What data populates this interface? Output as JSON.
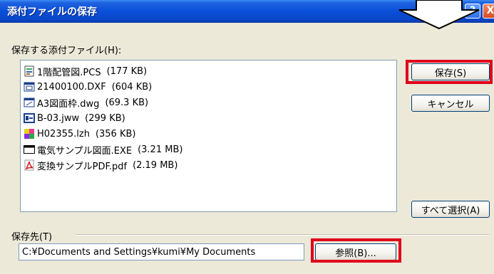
{
  "window": {
    "title": "添付ファイルの保存",
    "help_label": "?",
    "close_label": "X"
  },
  "files_label": "保存する添付ファイル(H):",
  "files": [
    {
      "name": "1階配管図.PCS",
      "size": "(177 KB)",
      "icon": "pcs-file-icon"
    },
    {
      "name": "21400100.DXF",
      "size": "(604 KB)",
      "icon": "dxf-file-icon"
    },
    {
      "name": "A3図面枠.dwg",
      "size": "(69.3 KB)",
      "icon": "dwg-file-icon"
    },
    {
      "name": "B-03.jww",
      "size": "(299 KB)",
      "icon": "jww-file-icon"
    },
    {
      "name": "H02355.lzh",
      "size": "(356 KB)",
      "icon": "lzh-archive-icon"
    },
    {
      "name": "電気サンプル図面.EXE",
      "size": "(3.21 MB)",
      "icon": "exe-window-icon"
    },
    {
      "name": "変換サンプルPDF.pdf",
      "size": "(2.19 MB)",
      "icon": "pdf-file-icon"
    }
  ],
  "buttons": {
    "save": "保存(S)",
    "cancel": "キャンセル",
    "select_all": "すべて選択(A)",
    "browse": "参照(B)..."
  },
  "destination": {
    "label": "保存先(T)",
    "path": "C:¥Documents and Settings¥kumi¥My Documents"
  },
  "colors": {
    "titlebar": "#0a50d8",
    "dialog_bg": "#ece9d8",
    "highlight": "#e0001a"
  }
}
